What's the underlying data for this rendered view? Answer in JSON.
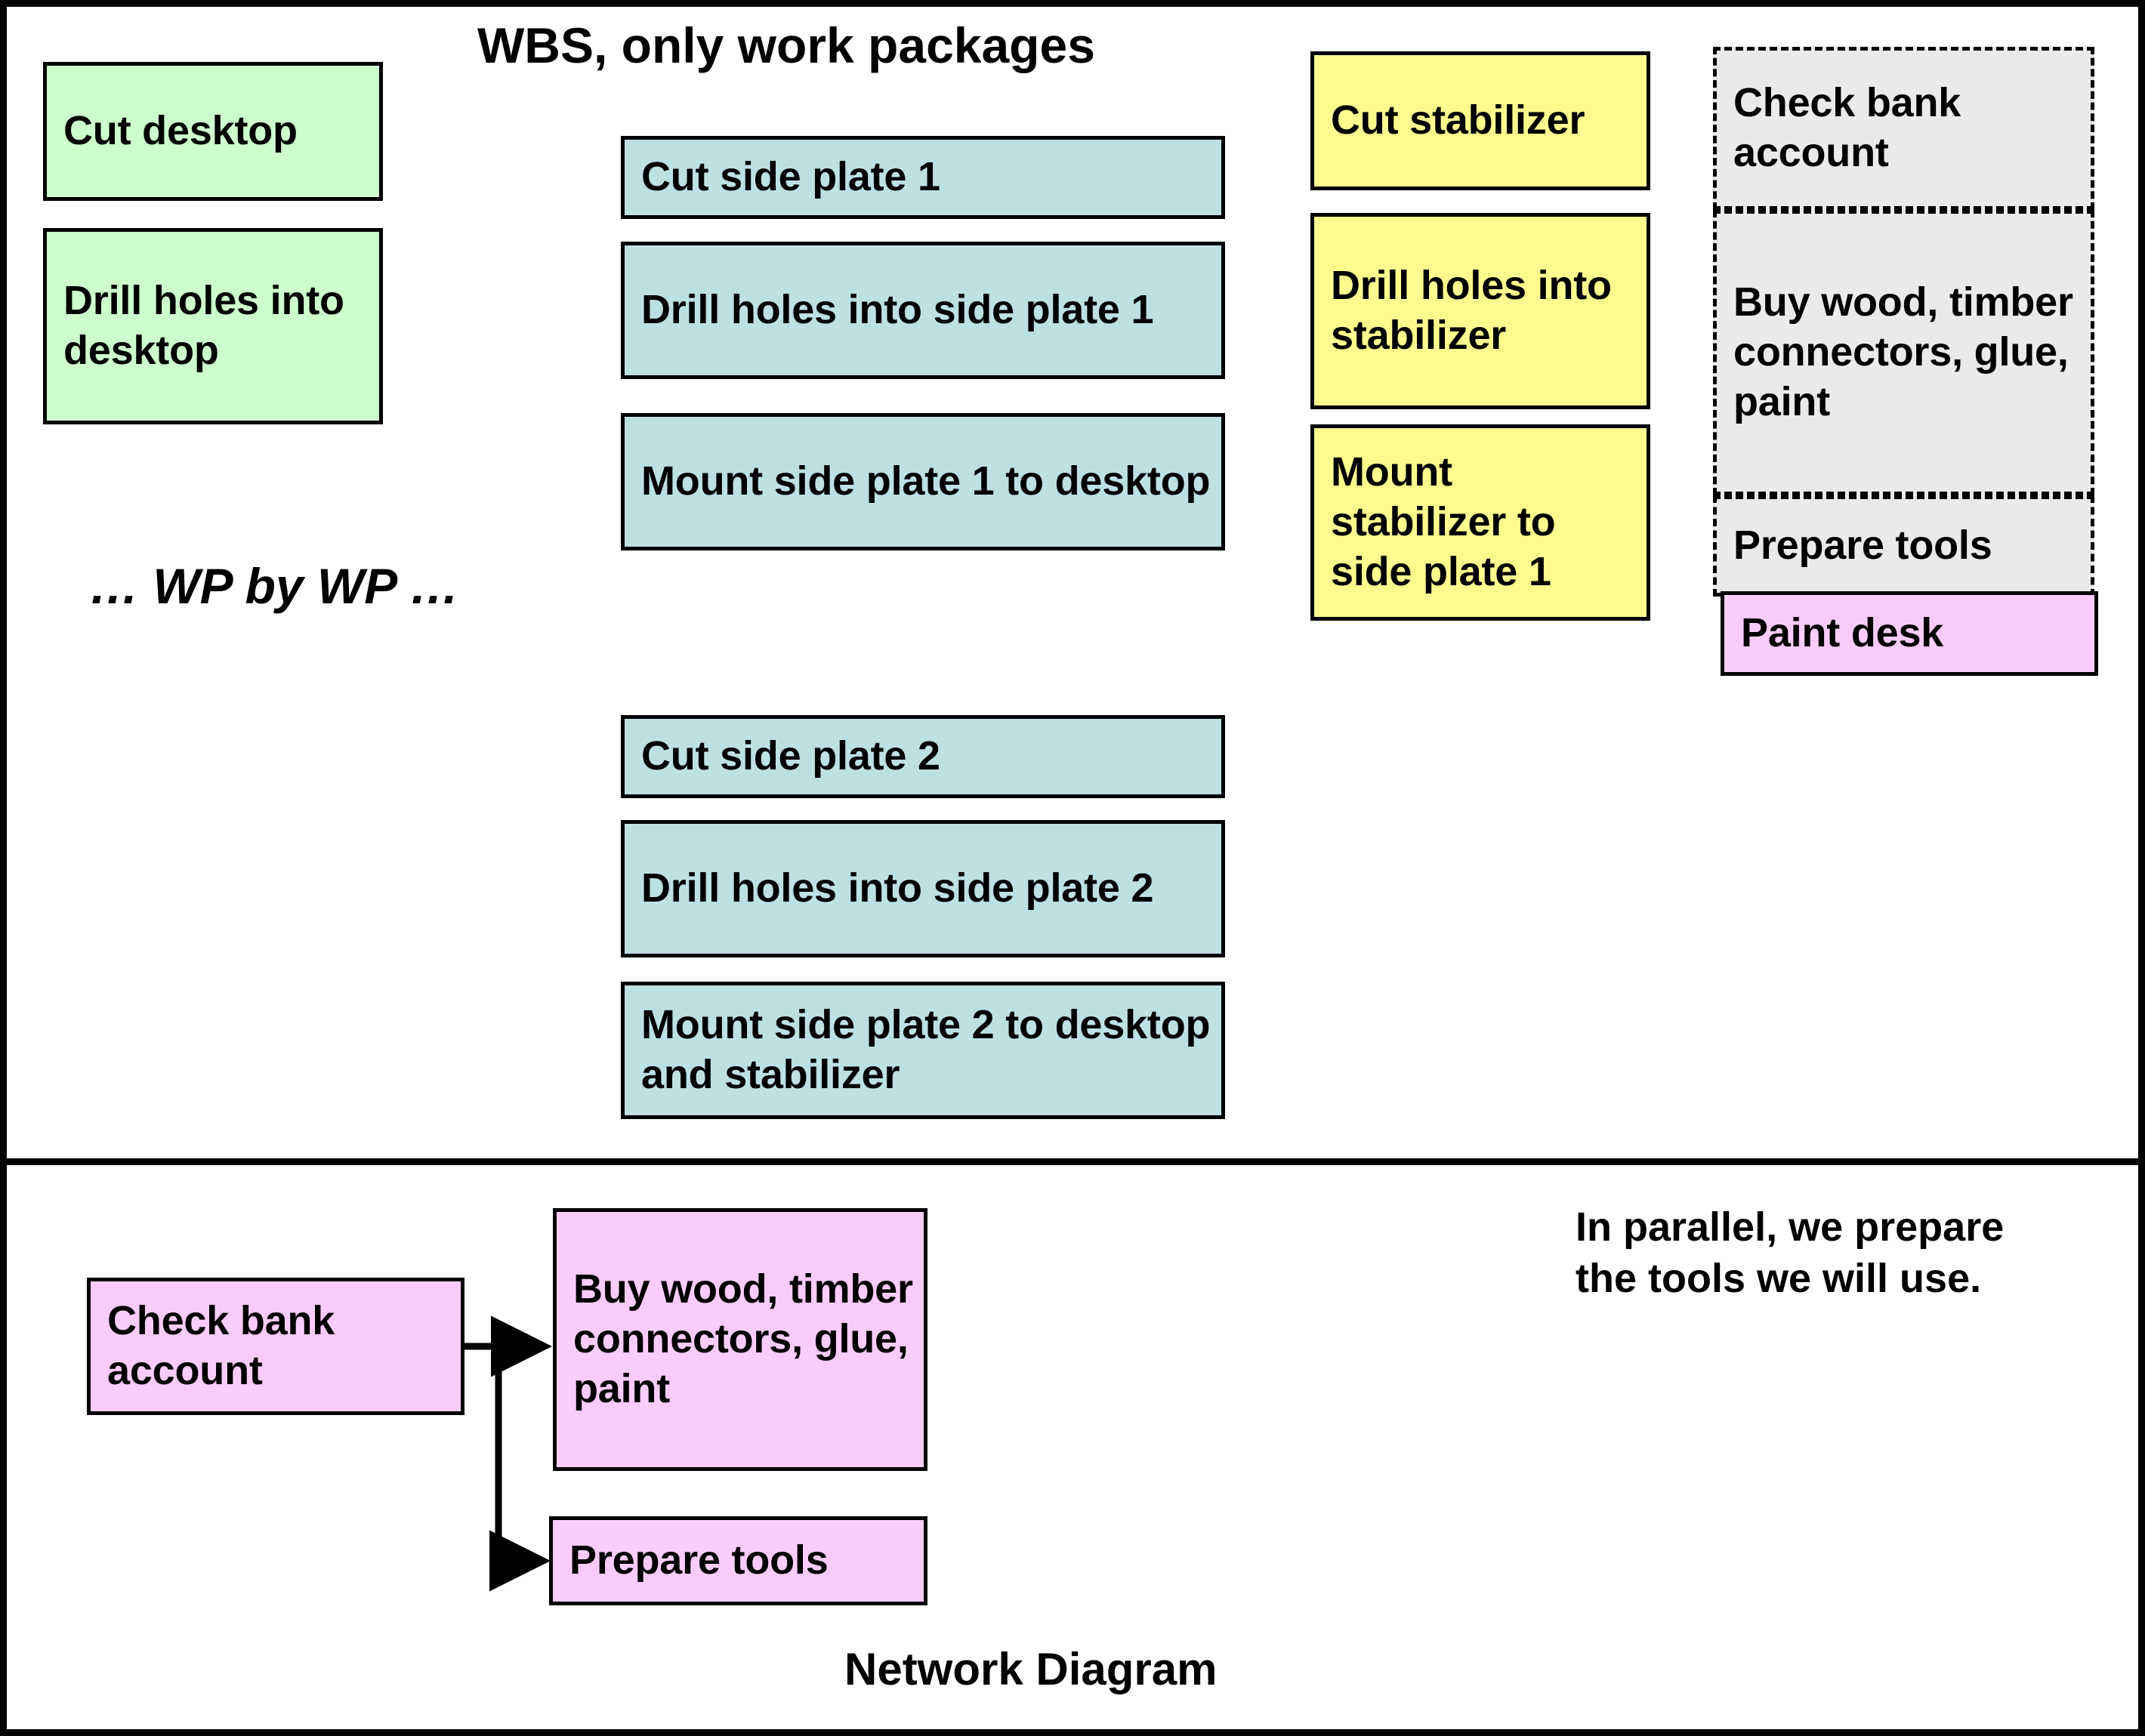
{
  "slide": {
    "wbs_title": "WBS, only work packages",
    "network_title": "Network Diagram",
    "ellipsis_note": "… WP by WP …",
    "parallel_note_line1": "In parallel, we prepare",
    "parallel_note_line2": "the tools we will use."
  },
  "colors": {
    "green": "#CCFFCC",
    "blue": "#BDE0E3",
    "yellow": "#FDFB8E",
    "pink": "#FBCCFB",
    "gray": "#EAEAEA",
    "border": "#000000",
    "background": "#FFFFFF"
  },
  "wbs": {
    "desktop_group": [
      {
        "label": "Cut desktop"
      },
      {
        "label": "Drill holes into desktop"
      }
    ],
    "side_plate_1_group": [
      {
        "label": "Cut side plate 1"
      },
      {
        "label": "Drill holes into side plate 1"
      },
      {
        "label": "Mount side plate 1 to desktop"
      }
    ],
    "side_plate_2_group": [
      {
        "label": "Cut side plate 2"
      },
      {
        "label": "Drill holes into side plate 2"
      },
      {
        "label": "Mount side plate 2 to desktop and stabilizer"
      }
    ],
    "stabilizer_group": [
      {
        "label": "Cut stabilizer"
      },
      {
        "label": "Drill holes into stabilizer"
      },
      {
        "label": "Mount stabilizer to side plate 1"
      }
    ],
    "procurement_group": [
      {
        "label": "Check bank account"
      },
      {
        "label": "Buy wood, timber connectors, glue, paint"
      },
      {
        "label": "Prepare tools"
      }
    ],
    "finishing_group": [
      {
        "label": "Paint desk"
      }
    ]
  },
  "network": {
    "nodes": [
      {
        "label": "Check bank account"
      },
      {
        "label": "Buy wood, timber connectors, glue, paint"
      },
      {
        "label": "Prepare tools"
      }
    ],
    "edges": [
      {
        "from": "Check bank account",
        "to": "Buy wood, timber connectors, glue, paint"
      },
      {
        "from": "Check bank account",
        "to": "Prepare tools"
      }
    ]
  }
}
